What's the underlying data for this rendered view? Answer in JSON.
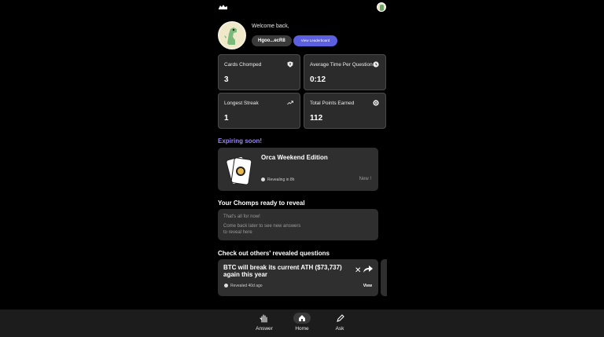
{
  "header": {
    "logo_icon": "chomp-logo-icon",
    "avatar_icon": "user-avatar-icon"
  },
  "profile": {
    "welcome": "Welcome back,",
    "handle": "Hgoo...ecR8",
    "leaderboard_button": "View Leaderboard"
  },
  "stats": [
    {
      "label": "Cards Chomped",
      "value": "3",
      "icon": "shield-icon"
    },
    {
      "label": "Average Time Per Question",
      "value": "0:12",
      "icon": "clock-icon"
    },
    {
      "label": "Longest Streak",
      "value": "1",
      "icon": "trending-up-icon"
    },
    {
      "label": "Total Points Earned",
      "value": "112",
      "icon": "points-icon"
    }
  ],
  "expiring": {
    "title": "Expiring soon!",
    "card": {
      "name": "Orca Weekend Edition",
      "reveal": "Revealing in 8h",
      "tag": "New !"
    }
  },
  "chomps": {
    "title": "Your Chomps ready to reveal",
    "empty_line1": "That's all for now!",
    "empty_line2": "Come back later to see new answers to reveal here"
  },
  "others": {
    "title": "Check out others' revealed questions",
    "question": "BTC will break its current ATH ($73,737) again this year",
    "revealed": "Revealed 40d ago",
    "view_label": "View"
  },
  "nav": [
    {
      "label": "Answer",
      "icon": "hand-icon"
    },
    {
      "label": "Home",
      "icon": "home-icon"
    },
    {
      "label": "Ask",
      "icon": "pencil-icon"
    }
  ],
  "colors": {
    "accent": "#5b5fe0",
    "expiring": "#9b86f0",
    "card_bg": "#2f2f2f"
  }
}
